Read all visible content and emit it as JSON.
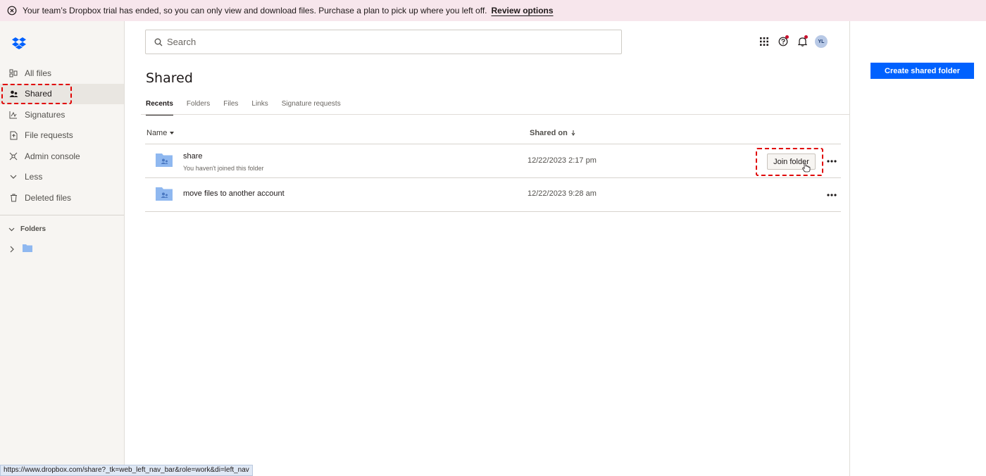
{
  "banner": {
    "message": "Your team’s Dropbox trial has ended, so you can only view and download files. Purchase a plan to pick up where you left off.",
    "link": "Review options"
  },
  "sidebar": {
    "items": [
      {
        "label": "All files",
        "icon": "all-files-icon"
      },
      {
        "label": "Shared",
        "icon": "shared-icon",
        "active": true
      },
      {
        "label": "Signatures",
        "icon": "signature-icon"
      },
      {
        "label": "File requests",
        "icon": "file-request-icon"
      },
      {
        "label": "Admin console",
        "icon": "admin-icon"
      },
      {
        "label": "Less",
        "icon": "chevron-down-icon"
      },
      {
        "label": "Deleted files",
        "icon": "trash-icon"
      }
    ],
    "folders_heading": "Folders"
  },
  "search": {
    "placeholder": "Search"
  },
  "header": {
    "avatar_initials": "YL"
  },
  "page": {
    "title": "Shared"
  },
  "tabs": [
    {
      "label": "Recents",
      "active": true
    },
    {
      "label": "Folders"
    },
    {
      "label": "Files"
    },
    {
      "label": "Links"
    },
    {
      "label": "Signature requests"
    }
  ],
  "actions": {
    "create_shared_folder": "Create shared folder"
  },
  "table": {
    "columns": {
      "name": "Name",
      "shared_on": "Shared on"
    },
    "rows": [
      {
        "name": "share",
        "subtitle": "You haven't joined this folder",
        "date": "12/22/2023 2:17 pm",
        "action": "Join folder"
      },
      {
        "name": "move files to another account",
        "subtitle": "",
        "date": "12/22/2023 9:28 am"
      }
    ]
  },
  "status_bar": {
    "url": "https://www.dropbox.com/share?_tk=web_left_nav_bar&role=work&di=left_nav"
  },
  "colors": {
    "accent": "#0061fe",
    "banner_bg": "#f7e6ec",
    "highlight": "#e00000",
    "folder": "#8fb8f0"
  }
}
